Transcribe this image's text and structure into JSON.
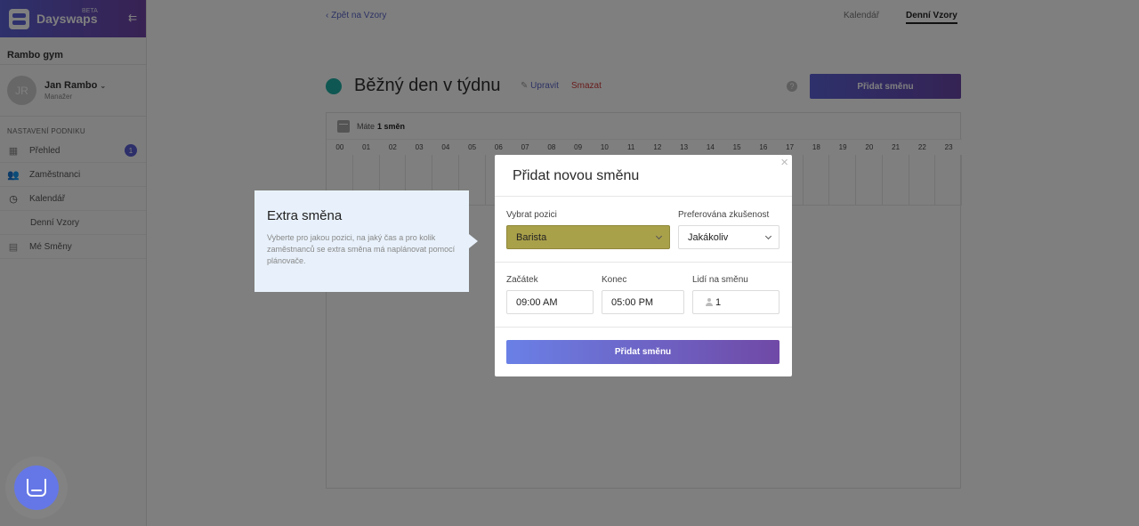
{
  "brand": {
    "name": "Dayswaps",
    "badge": "BETA",
    "collapse_icon": "collapse-sidebar-icon"
  },
  "sidebar": {
    "company": "Rambo gym",
    "user": {
      "initials": "JR",
      "name": "Jan Rambo",
      "role": "Manažer"
    },
    "section_heading": "NASTAVENÍ PODNIKU",
    "items": [
      {
        "label": "Přehled",
        "icon": "grid-icon",
        "badge": "1"
      },
      {
        "label": "Zaměstnanci",
        "icon": "people-icon"
      },
      {
        "label": "Kalendář",
        "icon": "clock-icon"
      },
      {
        "label": "Denní Vzory"
      },
      {
        "label": "Mé Směny",
        "icon": "calendar-icon"
      }
    ]
  },
  "topnav": {
    "back": "‹ Zpět na Vzory",
    "tabs": [
      {
        "label": "Kalendář",
        "active": false
      },
      {
        "label": "Denní Vzory",
        "active": true
      }
    ]
  },
  "template": {
    "title": "Běžný den v týdnu",
    "color": "#1eafa4",
    "edit": "Upravit",
    "delete": "Smazat",
    "add_shift": "Přidat směnu",
    "summary_prefix": "Máte",
    "summary_count": "1 směn"
  },
  "hours": [
    "00",
    "01",
    "02",
    "03",
    "04",
    "05",
    "06",
    "07",
    "08",
    "09",
    "10",
    "11",
    "12",
    "13",
    "14",
    "15",
    "16",
    "17",
    "18",
    "19",
    "20",
    "21",
    "22",
    "23"
  ],
  "tooltip": {
    "title": "Extra směna",
    "text": "Vyberte pro jakou pozici, na jaký čas a pro kolik zaměstnanců se extra směna má naplánovat pomocí plánovače."
  },
  "modal": {
    "title": "Přidat novou směnu",
    "position": {
      "label": "Vybrat pozici",
      "value": "Barista"
    },
    "experience": {
      "label": "Preferována zkušenost",
      "value": "Jakákoliv"
    },
    "start": {
      "label": "Začátek",
      "value": "09:00 AM"
    },
    "end": {
      "label": "Konec",
      "value": "05:00 PM"
    },
    "people": {
      "label": "Lidí na směnu",
      "value": "1"
    },
    "submit": "Přidat směnu"
  }
}
